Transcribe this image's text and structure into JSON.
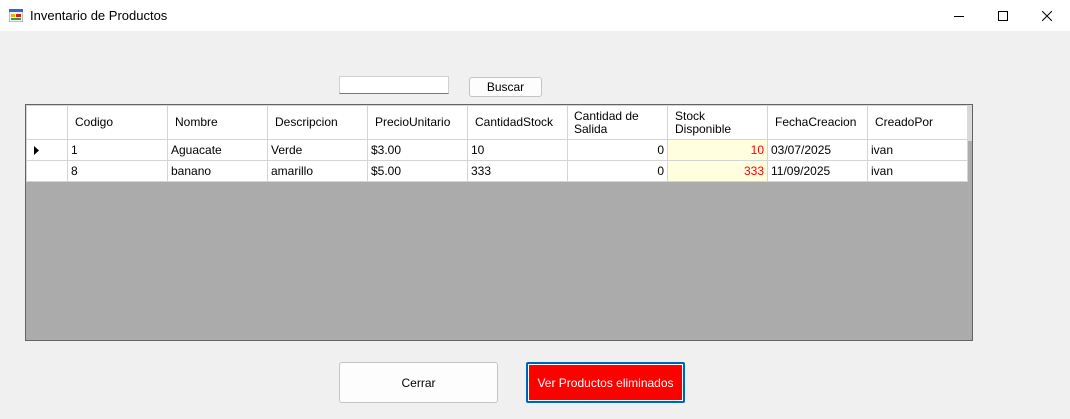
{
  "window": {
    "title": "Inventario de Productos",
    "controls": [
      "minimize-icon",
      "maximize-icon",
      "close-icon"
    ]
  },
  "search": {
    "value": "",
    "button_label": "Buscar"
  },
  "grid": {
    "columns": [
      "Codigo",
      "Nombre",
      "Descripcion",
      "PrecioUnitario",
      "CantidadStock",
      "Cantidad de Salida",
      "Stock Disponible",
      "FechaCreacion",
      "CreadoPor"
    ],
    "rows": [
      {
        "codigo": "1",
        "nombre": "Aguacate",
        "descripcion": "Verde",
        "precio": "$3.00",
        "cantidad_stock": "10",
        "cantidad_salida": "0",
        "stock_disponible": "10",
        "fecha": "03/07/2025",
        "creado_por": "ivan",
        "current": true
      },
      {
        "codigo": "8",
        "nombre": "banano",
        "descripcion": "amarillo",
        "precio": "$5.00",
        "cantidad_stock": "333",
        "cantidad_salida": "0",
        "stock_disponible": "333",
        "fecha": "11/09/2025",
        "creado_por": "ivan",
        "current": false
      }
    ],
    "current_row_icon": "row-selector-arrow-icon"
  },
  "footer": {
    "close_label": "Cerrar",
    "deleted_label": "Ver Productos eliminados"
  },
  "colors": {
    "accent_red": "#ff0000",
    "focus_blue": "#0067c0",
    "stock_cell_bg": "#ffffe0",
    "grid_background": "#ababab"
  }
}
